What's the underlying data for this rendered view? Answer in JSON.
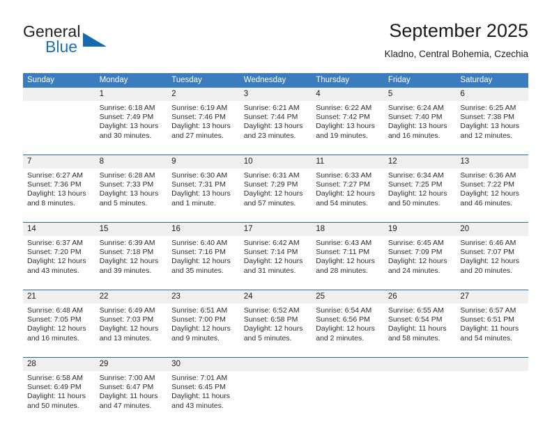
{
  "brand": {
    "name_part1": "General",
    "name_part2": "Blue",
    "logo_icon": "triangle-flag-icon",
    "accent_color": "#166bb0"
  },
  "header": {
    "month_title": "September 2025",
    "location": "Kladno, Central Bohemia, Czechia"
  },
  "calendar": {
    "header_bg": "#3a7cbe",
    "daynum_bg": "#f0f0f0",
    "separator_color": "#1e6bb0",
    "weekday_headers": [
      "Sunday",
      "Monday",
      "Tuesday",
      "Wednesday",
      "Thursday",
      "Friday",
      "Saturday"
    ],
    "weeks": [
      {
        "days": [
          {
            "num": "",
            "sunrise": "",
            "sunset": "",
            "daylight1": "",
            "daylight2": ""
          },
          {
            "num": "1",
            "sunrise": "Sunrise: 6:18 AM",
            "sunset": "Sunset: 7:49 PM",
            "daylight1": "Daylight: 13 hours",
            "daylight2": "and 30 minutes."
          },
          {
            "num": "2",
            "sunrise": "Sunrise: 6:19 AM",
            "sunset": "Sunset: 7:46 PM",
            "daylight1": "Daylight: 13 hours",
            "daylight2": "and 27 minutes."
          },
          {
            "num": "3",
            "sunrise": "Sunrise: 6:21 AM",
            "sunset": "Sunset: 7:44 PM",
            "daylight1": "Daylight: 13 hours",
            "daylight2": "and 23 minutes."
          },
          {
            "num": "4",
            "sunrise": "Sunrise: 6:22 AM",
            "sunset": "Sunset: 7:42 PM",
            "daylight1": "Daylight: 13 hours",
            "daylight2": "and 19 minutes."
          },
          {
            "num": "5",
            "sunrise": "Sunrise: 6:24 AM",
            "sunset": "Sunset: 7:40 PM",
            "daylight1": "Daylight: 13 hours",
            "daylight2": "and 16 minutes."
          },
          {
            "num": "6",
            "sunrise": "Sunrise: 6:25 AM",
            "sunset": "Sunset: 7:38 PM",
            "daylight1": "Daylight: 13 hours",
            "daylight2": "and 12 minutes."
          }
        ]
      },
      {
        "days": [
          {
            "num": "7",
            "sunrise": "Sunrise: 6:27 AM",
            "sunset": "Sunset: 7:36 PM",
            "daylight1": "Daylight: 13 hours",
            "daylight2": "and 8 minutes."
          },
          {
            "num": "8",
            "sunrise": "Sunrise: 6:28 AM",
            "sunset": "Sunset: 7:33 PM",
            "daylight1": "Daylight: 13 hours",
            "daylight2": "and 5 minutes."
          },
          {
            "num": "9",
            "sunrise": "Sunrise: 6:30 AM",
            "sunset": "Sunset: 7:31 PM",
            "daylight1": "Daylight: 13 hours",
            "daylight2": "and 1 minute."
          },
          {
            "num": "10",
            "sunrise": "Sunrise: 6:31 AM",
            "sunset": "Sunset: 7:29 PM",
            "daylight1": "Daylight: 12 hours",
            "daylight2": "and 57 minutes."
          },
          {
            "num": "11",
            "sunrise": "Sunrise: 6:33 AM",
            "sunset": "Sunset: 7:27 PM",
            "daylight1": "Daylight: 12 hours",
            "daylight2": "and 54 minutes."
          },
          {
            "num": "12",
            "sunrise": "Sunrise: 6:34 AM",
            "sunset": "Sunset: 7:25 PM",
            "daylight1": "Daylight: 12 hours",
            "daylight2": "and 50 minutes."
          },
          {
            "num": "13",
            "sunrise": "Sunrise: 6:36 AM",
            "sunset": "Sunset: 7:22 PM",
            "daylight1": "Daylight: 12 hours",
            "daylight2": "and 46 minutes."
          }
        ]
      },
      {
        "days": [
          {
            "num": "14",
            "sunrise": "Sunrise: 6:37 AM",
            "sunset": "Sunset: 7:20 PM",
            "daylight1": "Daylight: 12 hours",
            "daylight2": "and 43 minutes."
          },
          {
            "num": "15",
            "sunrise": "Sunrise: 6:39 AM",
            "sunset": "Sunset: 7:18 PM",
            "daylight1": "Daylight: 12 hours",
            "daylight2": "and 39 minutes."
          },
          {
            "num": "16",
            "sunrise": "Sunrise: 6:40 AM",
            "sunset": "Sunset: 7:16 PM",
            "daylight1": "Daylight: 12 hours",
            "daylight2": "and 35 minutes."
          },
          {
            "num": "17",
            "sunrise": "Sunrise: 6:42 AM",
            "sunset": "Sunset: 7:14 PM",
            "daylight1": "Daylight: 12 hours",
            "daylight2": "and 31 minutes."
          },
          {
            "num": "18",
            "sunrise": "Sunrise: 6:43 AM",
            "sunset": "Sunset: 7:11 PM",
            "daylight1": "Daylight: 12 hours",
            "daylight2": "and 28 minutes."
          },
          {
            "num": "19",
            "sunrise": "Sunrise: 6:45 AM",
            "sunset": "Sunset: 7:09 PM",
            "daylight1": "Daylight: 12 hours",
            "daylight2": "and 24 minutes."
          },
          {
            "num": "20",
            "sunrise": "Sunrise: 6:46 AM",
            "sunset": "Sunset: 7:07 PM",
            "daylight1": "Daylight: 12 hours",
            "daylight2": "and 20 minutes."
          }
        ]
      },
      {
        "days": [
          {
            "num": "21",
            "sunrise": "Sunrise: 6:48 AM",
            "sunset": "Sunset: 7:05 PM",
            "daylight1": "Daylight: 12 hours",
            "daylight2": "and 16 minutes."
          },
          {
            "num": "22",
            "sunrise": "Sunrise: 6:49 AM",
            "sunset": "Sunset: 7:03 PM",
            "daylight1": "Daylight: 12 hours",
            "daylight2": "and 13 minutes."
          },
          {
            "num": "23",
            "sunrise": "Sunrise: 6:51 AM",
            "sunset": "Sunset: 7:00 PM",
            "daylight1": "Daylight: 12 hours",
            "daylight2": "and 9 minutes."
          },
          {
            "num": "24",
            "sunrise": "Sunrise: 6:52 AM",
            "sunset": "Sunset: 6:58 PM",
            "daylight1": "Daylight: 12 hours",
            "daylight2": "and 5 minutes."
          },
          {
            "num": "25",
            "sunrise": "Sunrise: 6:54 AM",
            "sunset": "Sunset: 6:56 PM",
            "daylight1": "Daylight: 12 hours",
            "daylight2": "and 2 minutes."
          },
          {
            "num": "26",
            "sunrise": "Sunrise: 6:55 AM",
            "sunset": "Sunset: 6:54 PM",
            "daylight1": "Daylight: 11 hours",
            "daylight2": "and 58 minutes."
          },
          {
            "num": "27",
            "sunrise": "Sunrise: 6:57 AM",
            "sunset": "Sunset: 6:51 PM",
            "daylight1": "Daylight: 11 hours",
            "daylight2": "and 54 minutes."
          }
        ]
      },
      {
        "days": [
          {
            "num": "28",
            "sunrise": "Sunrise: 6:58 AM",
            "sunset": "Sunset: 6:49 PM",
            "daylight1": "Daylight: 11 hours",
            "daylight2": "and 50 minutes."
          },
          {
            "num": "29",
            "sunrise": "Sunrise: 7:00 AM",
            "sunset": "Sunset: 6:47 PM",
            "daylight1": "Daylight: 11 hours",
            "daylight2": "and 47 minutes."
          },
          {
            "num": "30",
            "sunrise": "Sunrise: 7:01 AM",
            "sunset": "Sunset: 6:45 PM",
            "daylight1": "Daylight: 11 hours",
            "daylight2": "and 43 minutes."
          },
          {
            "num": "",
            "sunrise": "",
            "sunset": "",
            "daylight1": "",
            "daylight2": ""
          },
          {
            "num": "",
            "sunrise": "",
            "sunset": "",
            "daylight1": "",
            "daylight2": ""
          },
          {
            "num": "",
            "sunrise": "",
            "sunset": "",
            "daylight1": "",
            "daylight2": ""
          },
          {
            "num": "",
            "sunrise": "",
            "sunset": "",
            "daylight1": "",
            "daylight2": ""
          }
        ]
      }
    ]
  }
}
